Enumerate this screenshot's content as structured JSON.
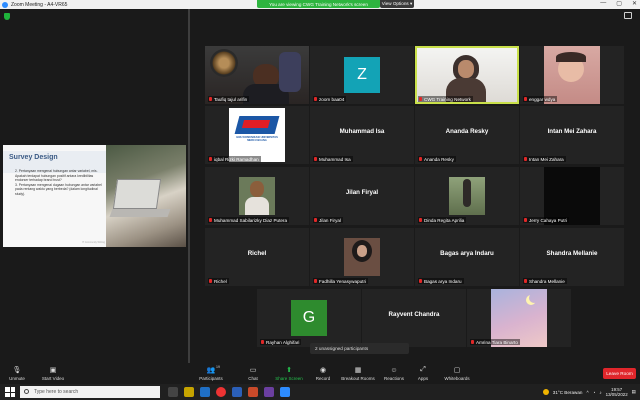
{
  "window": {
    "title": "Zoom Meeting - A4-VR65",
    "min": "—",
    "max": "▢",
    "close": "✕"
  },
  "banner": {
    "viewing": "You are viewing CWG Training Network's screen",
    "view_options": "View Options ▾"
  },
  "shared_slide": {
    "title": "Survey Design",
    "items": [
      "2. Pertanyaan mengenai hubungan antar variabel, mis. Apakah terdapat hubungan positif antara kredibilitas endorser terhadap brand trust?",
      "3. Pertanyaan mengenai dugaan hubungan antar variabel pada rentang waktu yang berbeda? (dalam longitudinal study)."
    ],
    "watermark": "IT Community Writing"
  },
  "tiles": [
    {
      "name": "Taufiq tajul arifin",
      "kind": "video",
      "center": ""
    },
    {
      "name": "zoom baa04",
      "kind": "avatar",
      "avatar": "Z",
      "avatar_color": "#13a3b6",
      "center": ""
    },
    {
      "name": "CWG Training Network",
      "kind": "video",
      "center": "",
      "active": true
    },
    {
      "name": "enggar wdya",
      "kind": "video",
      "center": ""
    },
    {
      "name": "iqbal Rizki Ramadhan",
      "kind": "logo",
      "center": "",
      "logo_text": "ILMU KOMUNIKASI UNIVERSITAS MERCU BUANA"
    },
    {
      "name": "Muhammad Isa",
      "kind": "name",
      "center": "Muhammad Isa"
    },
    {
      "name": "Ananda Resky",
      "kind": "name",
      "center": "Ananda Resky"
    },
    {
      "name": "Intan Mei Zahara",
      "kind": "name",
      "center": "Intan Mei Zahara"
    },
    {
      "name": "Muhammad Sabilarizky Diaz Putera",
      "kind": "video",
      "center": ""
    },
    {
      "name": "Jilan Firyal",
      "kind": "name",
      "center": "Jilan Firyal"
    },
    {
      "name": "Dinda Regita Aprilia",
      "kind": "video",
      "center": ""
    },
    {
      "name": "Jerry Cahaya Putri",
      "kind": "video",
      "center": ""
    },
    {
      "name": "Richel",
      "kind": "name",
      "center": "Richel"
    },
    {
      "name": "Fadhilla Yenasywaputri",
      "kind": "video",
      "center": ""
    },
    {
      "name": "Bagas arya Indaru",
      "kind": "name",
      "center": "Bagas arya Indaru"
    },
    {
      "name": "Shandra Mellanie",
      "kind": "name",
      "center": "Shandra Mellanie"
    },
    {
      "name": "Rayhan Alghifari",
      "kind": "avatar",
      "avatar": "G",
      "avatar_color": "#2e8b2e",
      "center": ""
    },
    {
      "name": "Rayvent Chandra",
      "kind": "name",
      "center": "Rayvent Chandra"
    },
    {
      "name": "Amrina Tiara Binarto",
      "kind": "video",
      "center": ""
    }
  ],
  "unassigned": "2 unassigned participants",
  "toolbar": {
    "unmute": "Unmute",
    "start_video": "Start Video",
    "participants": "Participants",
    "participants_count": "19",
    "chat": "Chat",
    "share_screen": "Share Screen",
    "record": "Record",
    "breakout_rooms": "Breakout Rooms",
    "reactions": "Reactions",
    "apps": "Apps",
    "whiteboards": "Whiteboards",
    "leave": "Leave Room"
  },
  "taskbar": {
    "search_placeholder": "Type here to search",
    "weather": "31°C  Berawan",
    "time": "19:57",
    "date": "13/05/2022"
  }
}
